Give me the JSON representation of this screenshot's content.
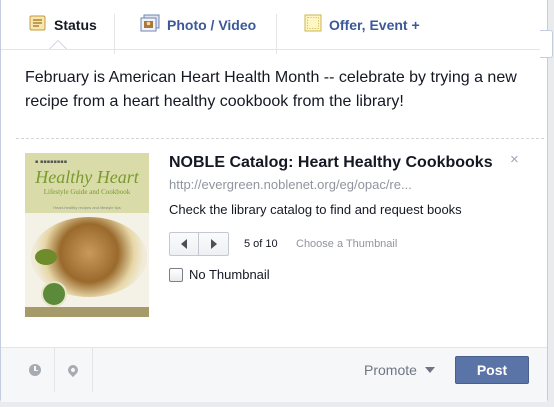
{
  "tabs": [
    {
      "label": "Status",
      "icon": "status-note-icon"
    },
    {
      "label": "Photo / Video",
      "icon": "photo-video-icon"
    },
    {
      "label": "Offer, Event +",
      "icon": "offer-event-icon"
    }
  ],
  "message": "February is American Heart Health Month -- celebrate by trying a new recipe from a heart healthy cookbook from the library!",
  "link_preview": {
    "title": "NOBLE Catalog: Heart Healthy Cookbooks",
    "url": "http://evergreen.noblenet.org/eg/opac/re...",
    "description": "Check the library catalog to find and request books",
    "thumbnail_counter": "5 of 10",
    "choose_thumbnail": "Choose a Thumbnail",
    "no_thumbnail_label": "No Thumbnail",
    "no_thumbnail_checked": false,
    "close_glyph": "×",
    "cover": {
      "title": "Healthy Heart",
      "subtitle": "Lifestyle Guide and Cookbook",
      "blurb": "Heart-healthy recipes and lifestyle tips"
    }
  },
  "footer": {
    "promote_label": "Promote",
    "post_label": "Post"
  },
  "colors": {
    "link_blue": "#3b5998",
    "post_button": "#5b74a8",
    "muted_text": "#90949c"
  }
}
